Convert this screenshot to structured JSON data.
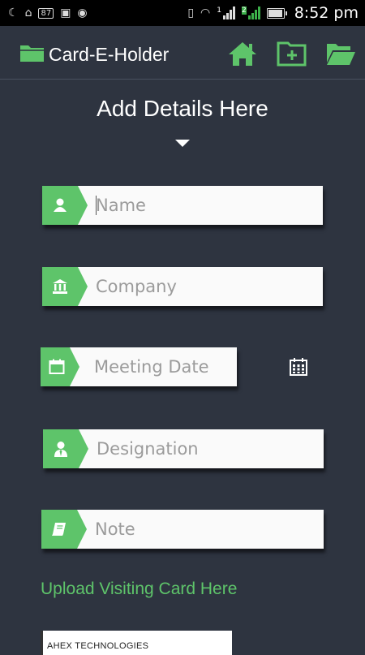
{
  "status_bar": {
    "battery_text": "87",
    "time": "8:52 pm",
    "signal_labels": [
      "1",
      "2"
    ],
    "battery_level": 0.87
  },
  "app_bar": {
    "title": "Card-E-Holder",
    "actions": [
      "home-icon",
      "folder-add-icon",
      "folder-open-icon"
    ],
    "accent": "#5ec46a"
  },
  "form": {
    "heading": "Add Details Here",
    "fields": {
      "name": {
        "placeholder": "Name",
        "icon": "person-icon"
      },
      "company": {
        "placeholder": "Company",
        "icon": "bank-icon"
      },
      "meeting_date": {
        "placeholder": "Meeting Date",
        "icon": "calendar-icon"
      },
      "designation": {
        "placeholder": "Designation",
        "icon": "person-tie-icon"
      },
      "note": {
        "placeholder": "Note",
        "icon": "notebook-icon"
      }
    },
    "upload_label": "Upload Visiting Card Here",
    "card_preview_text": "AHEX TECHNOLOGIES"
  },
  "colors": {
    "background": "#2e3440",
    "accent": "#5ec46a",
    "field_bg": "#fafafa"
  }
}
